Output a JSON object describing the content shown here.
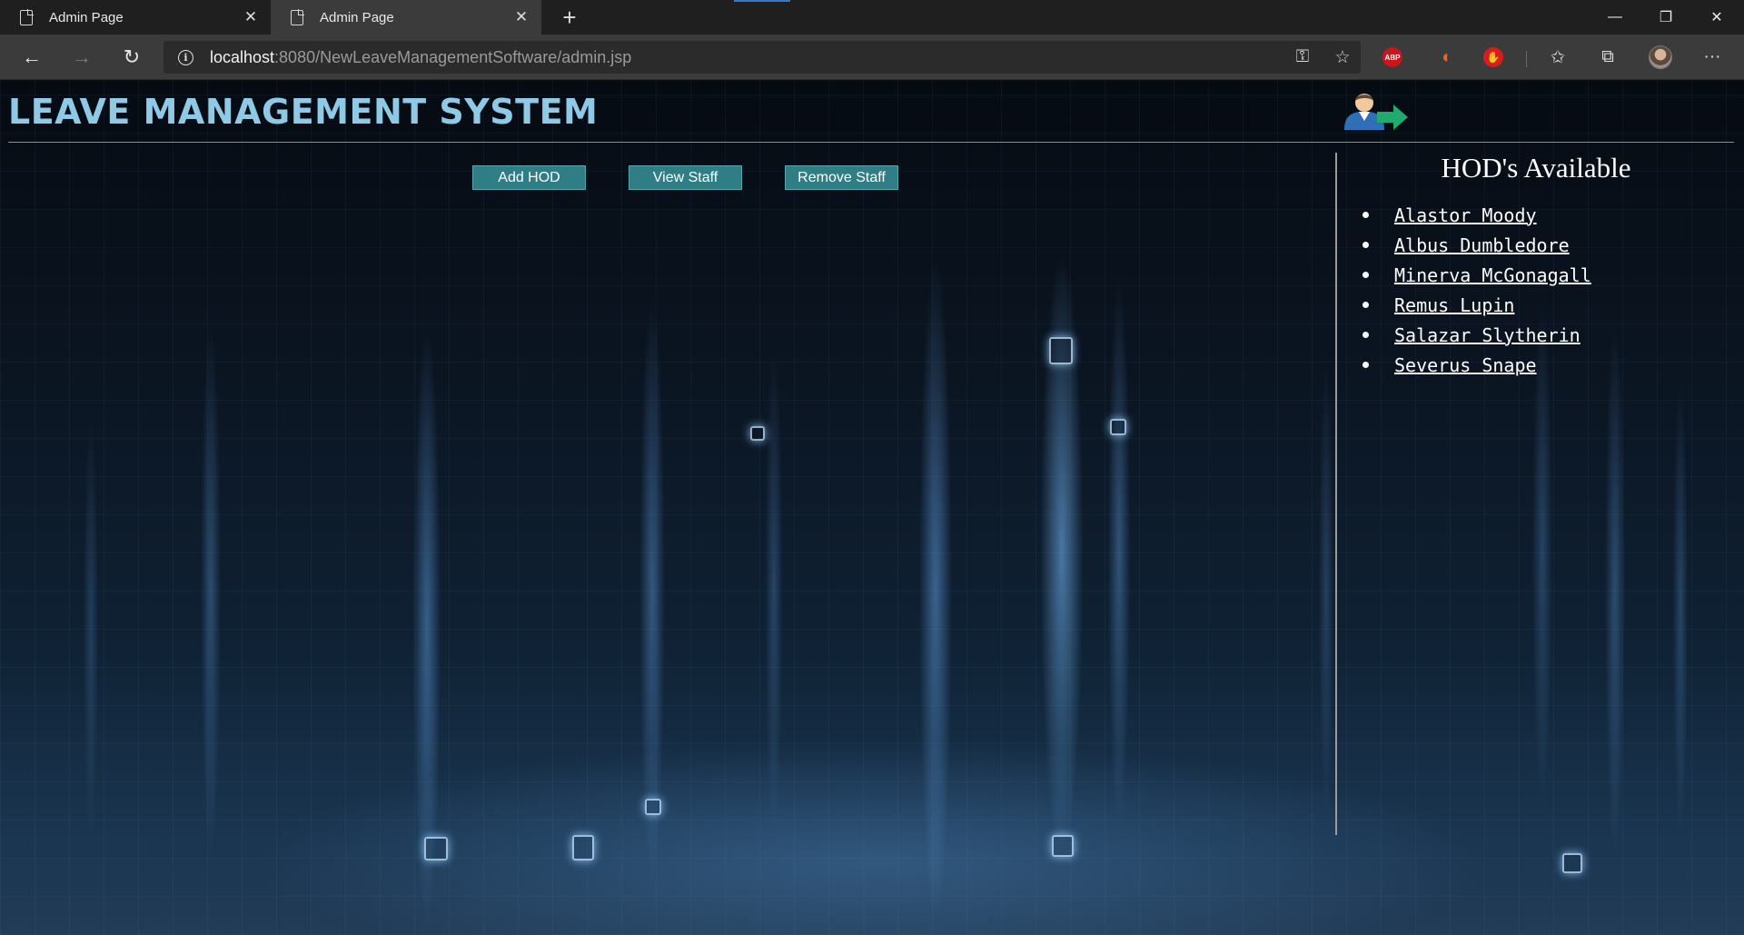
{
  "browser": {
    "tabs": [
      {
        "title": "Admin Page",
        "active": false
      },
      {
        "title": "Admin Page",
        "active": true
      }
    ],
    "new_tab_label": "+",
    "url_host": "localhost",
    "url_rest": ":8080/NewLeaveManagementSoftware/admin.jsp",
    "extensions": {
      "abp_label": "ABP"
    },
    "icons": [
      "back-icon",
      "forward-icon",
      "refresh-icon",
      "info-icon",
      "key-icon",
      "star-icon",
      "favorites-icon",
      "collections-icon",
      "profile-avatar",
      "more-icon",
      "minimize-icon",
      "restore-icon",
      "close-icon"
    ]
  },
  "page": {
    "title": "LEAVE MANAGEMENT SYSTEM",
    "logout_icon": "logout-user-arrow-icon",
    "buttons": {
      "add_hod": "Add HOD",
      "view_staff": "View Staff",
      "remove_staff": "Remove Staff"
    },
    "button_color": "#2f7e86",
    "title_color": "#8ecae6",
    "hod_panel": {
      "heading": "HOD's Available",
      "items": [
        "Alastor Moody",
        "Albus Dumbledore",
        "Minerva McGonagall",
        "Remus Lupin",
        "Salazar Slytherin",
        "Severus Snape"
      ]
    }
  }
}
